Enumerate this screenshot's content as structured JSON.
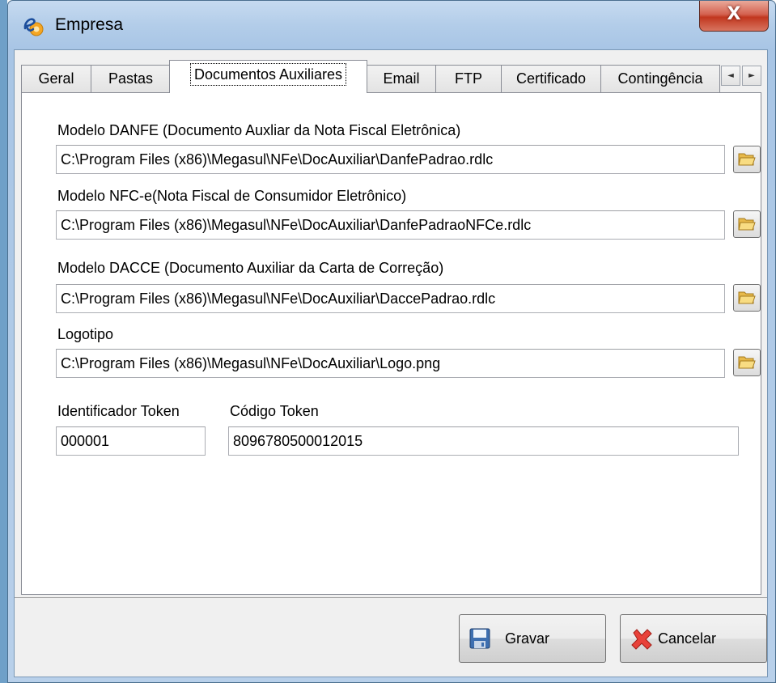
{
  "window": {
    "title": "Empresa",
    "close_label": "X"
  },
  "tabs": [
    {
      "label": "Geral",
      "active": false
    },
    {
      "label": "Pastas",
      "active": false
    },
    {
      "label": "Documentos Auxiliares",
      "active": true
    },
    {
      "label": "Email",
      "active": false
    },
    {
      "label": "FTP",
      "active": false
    },
    {
      "label": "Certificado",
      "active": false
    },
    {
      "label": "Contingência",
      "active": false
    }
  ],
  "tab_scroll": {
    "left": "◄",
    "right": "►"
  },
  "fields": {
    "danfe": {
      "label": "Modelo DANFE (Documento Auxliar da Nota Fiscal Eletrônica)",
      "value": "C:\\Program Files (x86)\\Megasul\\NFe\\DocAuxiliar\\DanfePadrao.rdlc"
    },
    "nfce": {
      "label": "Modelo NFC-e(Nota Fiscal de Consumidor Eletrônico)",
      "value": "C:\\Program Files (x86)\\Megasul\\NFe\\DocAuxiliar\\DanfePadraoNFCe.rdlc"
    },
    "dacce": {
      "label": "Modelo DACCE (Documento Auxiliar da Carta de Correção)",
      "value": "C:\\Program Files (x86)\\Megasul\\NFe\\DocAuxiliar\\DaccePadrao.rdlc"
    },
    "logo": {
      "label": "Logotipo",
      "value": "C:\\Program Files (x86)\\Megasul\\NFe\\DocAuxiliar\\Logo.png"
    },
    "token_id": {
      "label": "Identificador Token",
      "value": "000001"
    },
    "token_code": {
      "label": "Código Token",
      "value": "8096780500012015"
    }
  },
  "buttons": {
    "save": "Gravar",
    "cancel": "Cancelar"
  },
  "colors": {
    "title_gradient": "#b3cde9",
    "close_red": "#c1371f",
    "folder_yellow": "#f3d36b",
    "cancel_red": "#e8423a",
    "save_blue": "#3e6fb0"
  },
  "icons": {
    "app": "app-e-icon",
    "browse": "folder-open-icon",
    "save": "floppy-disk-icon",
    "cancel": "red-x-icon"
  }
}
